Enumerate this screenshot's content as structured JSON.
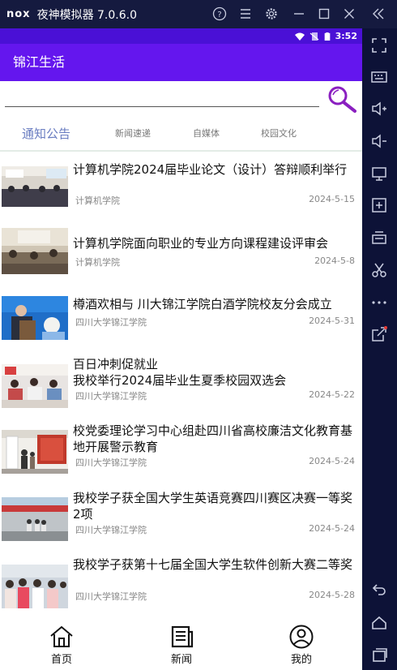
{
  "emulator": {
    "logo": "nox",
    "title": "夜神模拟器 7.0.6.0",
    "controls": [
      "help-icon",
      "menu-icon",
      "settings-icon",
      "minimize-icon",
      "maximize-icon",
      "close-icon",
      "collapse-icon"
    ]
  },
  "status_bar": {
    "time": "3:52",
    "icons": [
      "wifi-icon",
      "no-sim-icon",
      "battery-icon"
    ]
  },
  "app_bar": {
    "title": "锦江生活",
    "color": "#6416ee"
  },
  "search": {
    "value": "",
    "icon": "search-icon"
  },
  "tabs": [
    {
      "label": "通知公告",
      "active": true
    },
    {
      "label": "新闻速递",
      "active": false
    },
    {
      "label": "自媒体",
      "active": false
    },
    {
      "label": "校园文化",
      "active": false
    }
  ],
  "news": [
    {
      "title": "计算机学院2024届毕业论文（设计）答辩顺利举行",
      "source": "计算机学院",
      "date": "2024-5-15"
    },
    {
      "title": "计算机学院面向职业的专业方向课程建设评审会",
      "source": "计算机学院",
      "date": "2024-5-8"
    },
    {
      "title": "樽酒欢相与 川大锦江学院白酒学院校友分会成立",
      "source": "四川大学锦江学院",
      "date": "2024-5-31"
    },
    {
      "title": "百日冲刺促就业\n我校举行2024届毕业生夏季校园双选会",
      "source": "四川大学锦江学院",
      "date": "2024-5-22"
    },
    {
      "title": "校党委理论学习中心组赴四川省高校廉洁文化教育基地开展警示教育",
      "source": "四川大学锦江学院",
      "date": "2024-5-24"
    },
    {
      "title": "我校学子获全国大学生英语竞赛四川赛区决赛一等奖2项",
      "source": "四川大学锦江学院",
      "date": "2024-5-24"
    },
    {
      "title": "我校学子获第十七届全国大学生软件创新大赛二等奖",
      "source": "四川大学锦江学院",
      "date": "2024-5-28"
    }
  ],
  "bottom_nav": [
    {
      "label": "首页",
      "icon": "home-icon"
    },
    {
      "label": "新闻",
      "icon": "news-icon"
    },
    {
      "label": "我的",
      "icon": "profile-icon"
    }
  ],
  "emulator_sidebar": [
    "fullscreen-icon",
    "keyboard-icon",
    "volume-up-icon",
    "volume-down-icon",
    "screen-icon",
    "apk-install-icon",
    "screenshot-icon",
    "scissors-icon",
    "more-icon",
    "share-icon",
    "back-icon",
    "home-android-icon",
    "recent-apps-icon"
  ]
}
